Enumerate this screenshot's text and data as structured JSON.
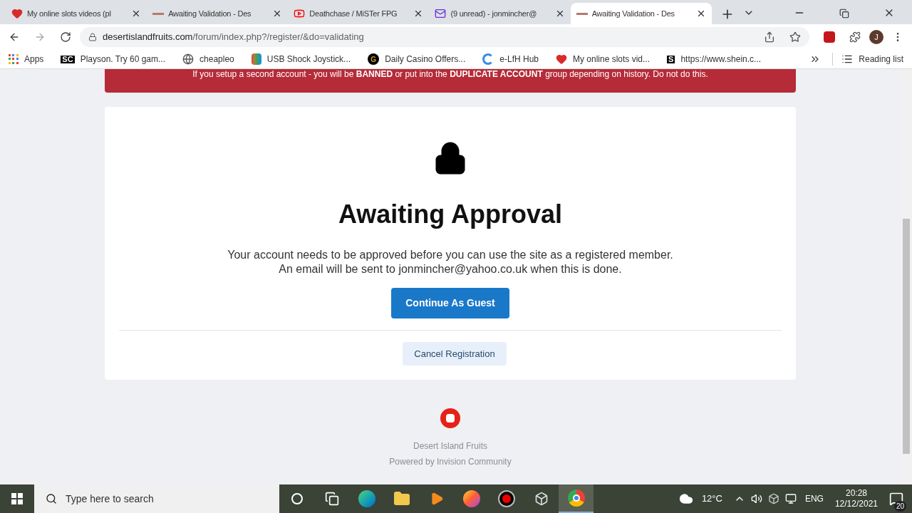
{
  "tabs": [
    {
      "title": "My online slots videos (pl",
      "selected": false
    },
    {
      "title": "Awaiting Validation - Des",
      "selected": false
    },
    {
      "title": "Deathchase / MiSTer FPG",
      "selected": false
    },
    {
      "title": "(9 unread) - jonmincher@",
      "selected": false
    },
    {
      "title": "Awaiting Validation - Des",
      "selected": true
    }
  ],
  "address": {
    "domain": "desertislandfruits.com",
    "path": "/forum/index.php?/register/&do=validating"
  },
  "profile_initial": "J",
  "bookmarks": [
    {
      "label": "Apps"
    },
    {
      "label": "Playson. Try 60 gam...",
      "icon_text": "SC"
    },
    {
      "label": "cheapleo"
    },
    {
      "label": "USB Shock Joystick..."
    },
    {
      "label": "Daily Casino Offers...",
      "icon_text": "G"
    },
    {
      "label": "e-LfH Hub"
    },
    {
      "label": "My online slots vid..."
    },
    {
      "label": "https://www.shein.c...",
      "icon_text": "S"
    }
  ],
  "reading_list": "Reading list",
  "banner": "If you setup a second account - you will be **BANNED** or put into the **DUPLICATE ACCOUNT** group depending on history.  Do not do this.",
  "card": {
    "title": "Awaiting Approval",
    "message_lines": [
      "Your account needs to be approved before you can use the site as a registered member.",
      "An email will be sent to jonmincher@yahoo.co.uk when this is done."
    ],
    "primary_button": "Continue As Guest",
    "secondary_button": "Cancel Registration"
  },
  "footer": {
    "site": "Desert Island Fruits",
    "powered": "Powered by Invision Community"
  },
  "taskbar": {
    "search_placeholder": "Type here to search",
    "apps": [
      {
        "selected": false
      },
      {
        "selected": false
      },
      {
        "selected": false
      },
      {
        "selected": false
      },
      {
        "selected": false
      },
      {
        "selected": false
      },
      {
        "selected": false
      },
      {
        "selected": false
      },
      {
        "selected": true
      }
    ],
    "temperature": "12°C",
    "language": "ENG",
    "time": "20:28",
    "date": "12/12/2021",
    "notifications": "20"
  }
}
